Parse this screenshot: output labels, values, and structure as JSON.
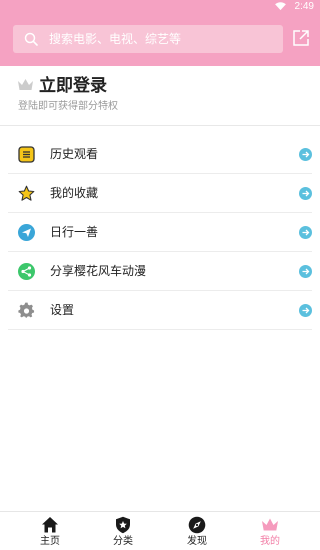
{
  "status_bar": {
    "time": "2:49"
  },
  "search": {
    "placeholder": "搜索电影、电视、综艺等"
  },
  "login": {
    "title": "立即登录",
    "subtitle": "登陆即可获得部分特权"
  },
  "menu": [
    {
      "label": "历史观看",
      "icon": "history-icon",
      "color": "#f5c518"
    },
    {
      "label": "我的收藏",
      "icon": "star-icon",
      "color": "#f5c518"
    },
    {
      "label": "日行一善",
      "icon": "paper-plane-icon",
      "color": "#3aa6d8"
    },
    {
      "label": "分享樱花风车动漫",
      "icon": "share-nodes-icon",
      "color": "#3cc76b"
    },
    {
      "label": "设置",
      "icon": "gear-icon",
      "color": "#888888"
    }
  ],
  "tabs": [
    {
      "label": "主页",
      "icon": "home-icon"
    },
    {
      "label": "分类",
      "icon": "shield-star-icon"
    },
    {
      "label": "发现",
      "icon": "compass-icon"
    },
    {
      "label": "我的",
      "icon": "crown-icon",
      "active": true
    }
  ],
  "colors": {
    "header": "#f5a2c2",
    "accent": "#f27ea6",
    "arrow": "#5bc0de"
  }
}
